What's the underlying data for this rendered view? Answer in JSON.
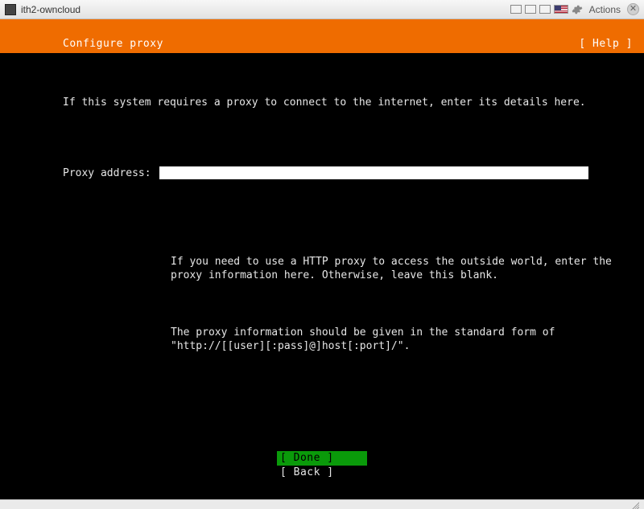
{
  "vm": {
    "title": "ith2-owncloud",
    "actions_label": "Actions"
  },
  "screen": {
    "title": "Configure proxy",
    "help_label": "[ Help ]",
    "intro": "If this system requires a proxy to connect to the internet, enter its details here.",
    "proxy_label": "Proxy address:",
    "proxy_value": "",
    "help1": "If you need to use a HTTP proxy to access the outside world, enter the proxy information here. Otherwise, leave this blank.",
    "help2": "The proxy information should be given in the standard form of \"http://[[user][:pass]@]host[:port]/\".",
    "done_label": "[ Done       ]",
    "back_label": "[ Back       ]"
  }
}
